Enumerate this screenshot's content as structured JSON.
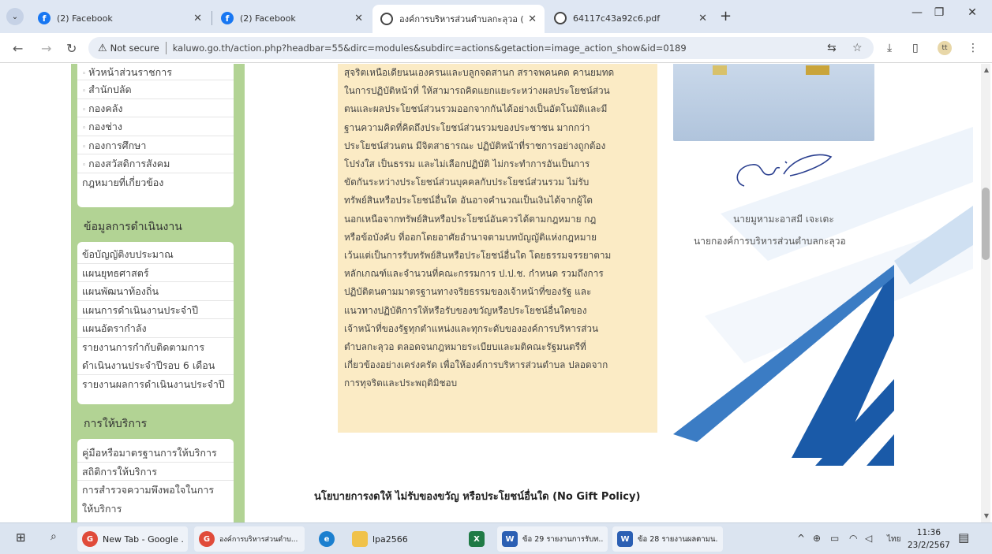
{
  "browser": {
    "tabs": [
      {
        "label": "(2) Facebook",
        "icon": "facebook-icon",
        "active": false
      },
      {
        "label": "(2) Facebook",
        "icon": "facebook-icon",
        "active": false
      },
      {
        "label": "องค์การบริหารส่วนตำบลกะลุวอ (อบ...",
        "icon": "globe-icon",
        "active": true
      },
      {
        "label": "64117c43a92c6.pdf",
        "icon": "globe-icon",
        "active": false
      }
    ],
    "address": {
      "security_label": "Not secure",
      "url": "kaluwo.go.th/action.php?headbar=55&dirc=modules&subdirc=actions&getaction=image_action_show&id=0189"
    }
  },
  "sidebar": {
    "top_items": [
      "หัวหน้าส่วนราชการ",
      "สำนักปลัด",
      "กองคลัง",
      "กองช่าง",
      "กองการศึกษา",
      "กองสวัสดิการสังคม"
    ],
    "top_last": "กฎหมายที่เกี่ยวข้อง",
    "section_operations": {
      "heading": "ข้อมูลการดำเนินงาน",
      "items": [
        "ข้อบัญญัติงบประมาณ",
        "แผนยุทธศาสตร์",
        "แผนพัฒนาท้องถิ่น",
        "แผนการดำเนินงานประจำปี",
        "แผนอัตรากำลัง",
        "รายงานการกำกับติดตามการ",
        "ดำเนินงานประจำปีรอบ 6 เดือน",
        "รายงานผลการดำเนินงานประจำปี"
      ]
    },
    "section_services": {
      "heading": "การให้บริการ",
      "items": [
        "คู่มือหรือมาตรฐานการให้บริการ",
        "สถิติการให้บริการ",
        "การสำรวจความพึงพอใจในการ",
        "ให้บริการ"
      ]
    }
  },
  "article": {
    "lines": [
      "สุจริตเหนือเดียนนเองครนและบลูกจดสานก สราจพคนคด คานยมทด",
      "ในการปฏิบัติหน้าที่ ให้สามารถคิดแยกแยะระหว่างผลประโยชน์ส่วน",
      "ตนและผลประโยชน์ส่วนรวมออกจากกันได้อย่างเป็นอัตโนมัติและมี",
      "ฐานความคิดที่คิดถึงประโยชน์ส่วนรวมของประชาชน มากกว่า",
      "ประโยชน์ส่วนตน มีจิตสาธารณะ ปฏิบัติหน้าที่ราชการอย่างถูกต้อง",
      "โปร่งใส เป็นธรรม และไม่เลือกปฏิบัติ ไม่กระทำการอันเป็นการ",
      "ขัดกันระหว่างประโยชน์ส่วนบุคคลกับประโยชน์ส่วนรวม ไม่รับ",
      "ทรัพย์สินหรือประโยชน์อื่นใด อันอาจคำนวณเป็นเงินได้จากผู้ใด",
      "นอกเหนือจากทรัพย์สินหรือประโยชน์อันควรได้ตามกฎหมาย กฎ",
      "หรือข้อบังคับ ที่ออกโดยอาศัยอำนาจตามบทบัญญัติแห่งกฎหมาย",
      "เว้นแต่เป็นการรับทรัพย์สินหรือประโยชน์อื่นใด โดยธรรมจรรยาตาม",
      "หลักเกณฑ์และจำนวนที่คณะกรรมการ ป.ป.ช. กำหนด รวมถึงการ",
      "ปฏิบัติตนตามมาตรฐานทางจริยธรรมของเจ้าหน้าที่ของรัฐ และ",
      "แนวทางปฏิบัติการให้หรือรับของขวัญหรือประโยชน์อื่นใดของ",
      "เจ้าหน้าที่ของรัฐทุกตำแหน่งและทุกระดับขององค์การบริหารส่วน",
      "ตำบลกะลุวอ ตลอดจนกฎหมายระเบียบและมติคณะรัฐมนตรีที่",
      "เกี่ยวข้องอย่างเคร่งครัด เพื่อให้องค์การบริหารส่วนตำบล ปลอดจาก",
      "การทุจริตและประพฤติมิชอบ"
    ]
  },
  "official": {
    "name": "นายมูหามะอาสมี เจะเตะ",
    "title": "นายกองค์การบริหารส่วนตำบลกะลุวอ"
  },
  "policy_heading": "นโยบายการงดให้ ไม่รับของขวัญ หรือประโยชน์อื่นใด (No Gift Policy)",
  "taskbar": {
    "items": [
      {
        "label": "New Tab - Google ...",
        "icon": "chrome-icon"
      },
      {
        "label": "องค์การบริหารส่วนตำบ...",
        "icon": "chrome-icon"
      },
      {
        "label": "",
        "icon": "edge-icon"
      },
      {
        "label": "lpa2566",
        "icon": "folder-icon"
      },
      {
        "label": "",
        "icon": "excel-icon"
      },
      {
        "label": "ข้อ 29 รายงานการรับท...",
        "icon": "word-icon"
      },
      {
        "label": "ข้อ 28 รายงานผลตามน...",
        "icon": "word-icon"
      }
    ],
    "lang": "ไทย",
    "time": "11:36",
    "date": "23/2/2567"
  },
  "colors": {
    "sidebar_green": "#b2d394",
    "article_bg": "#fbebc5",
    "accent_blue": "#1a5aa8",
    "tab_strip": "#dfe7f3"
  }
}
